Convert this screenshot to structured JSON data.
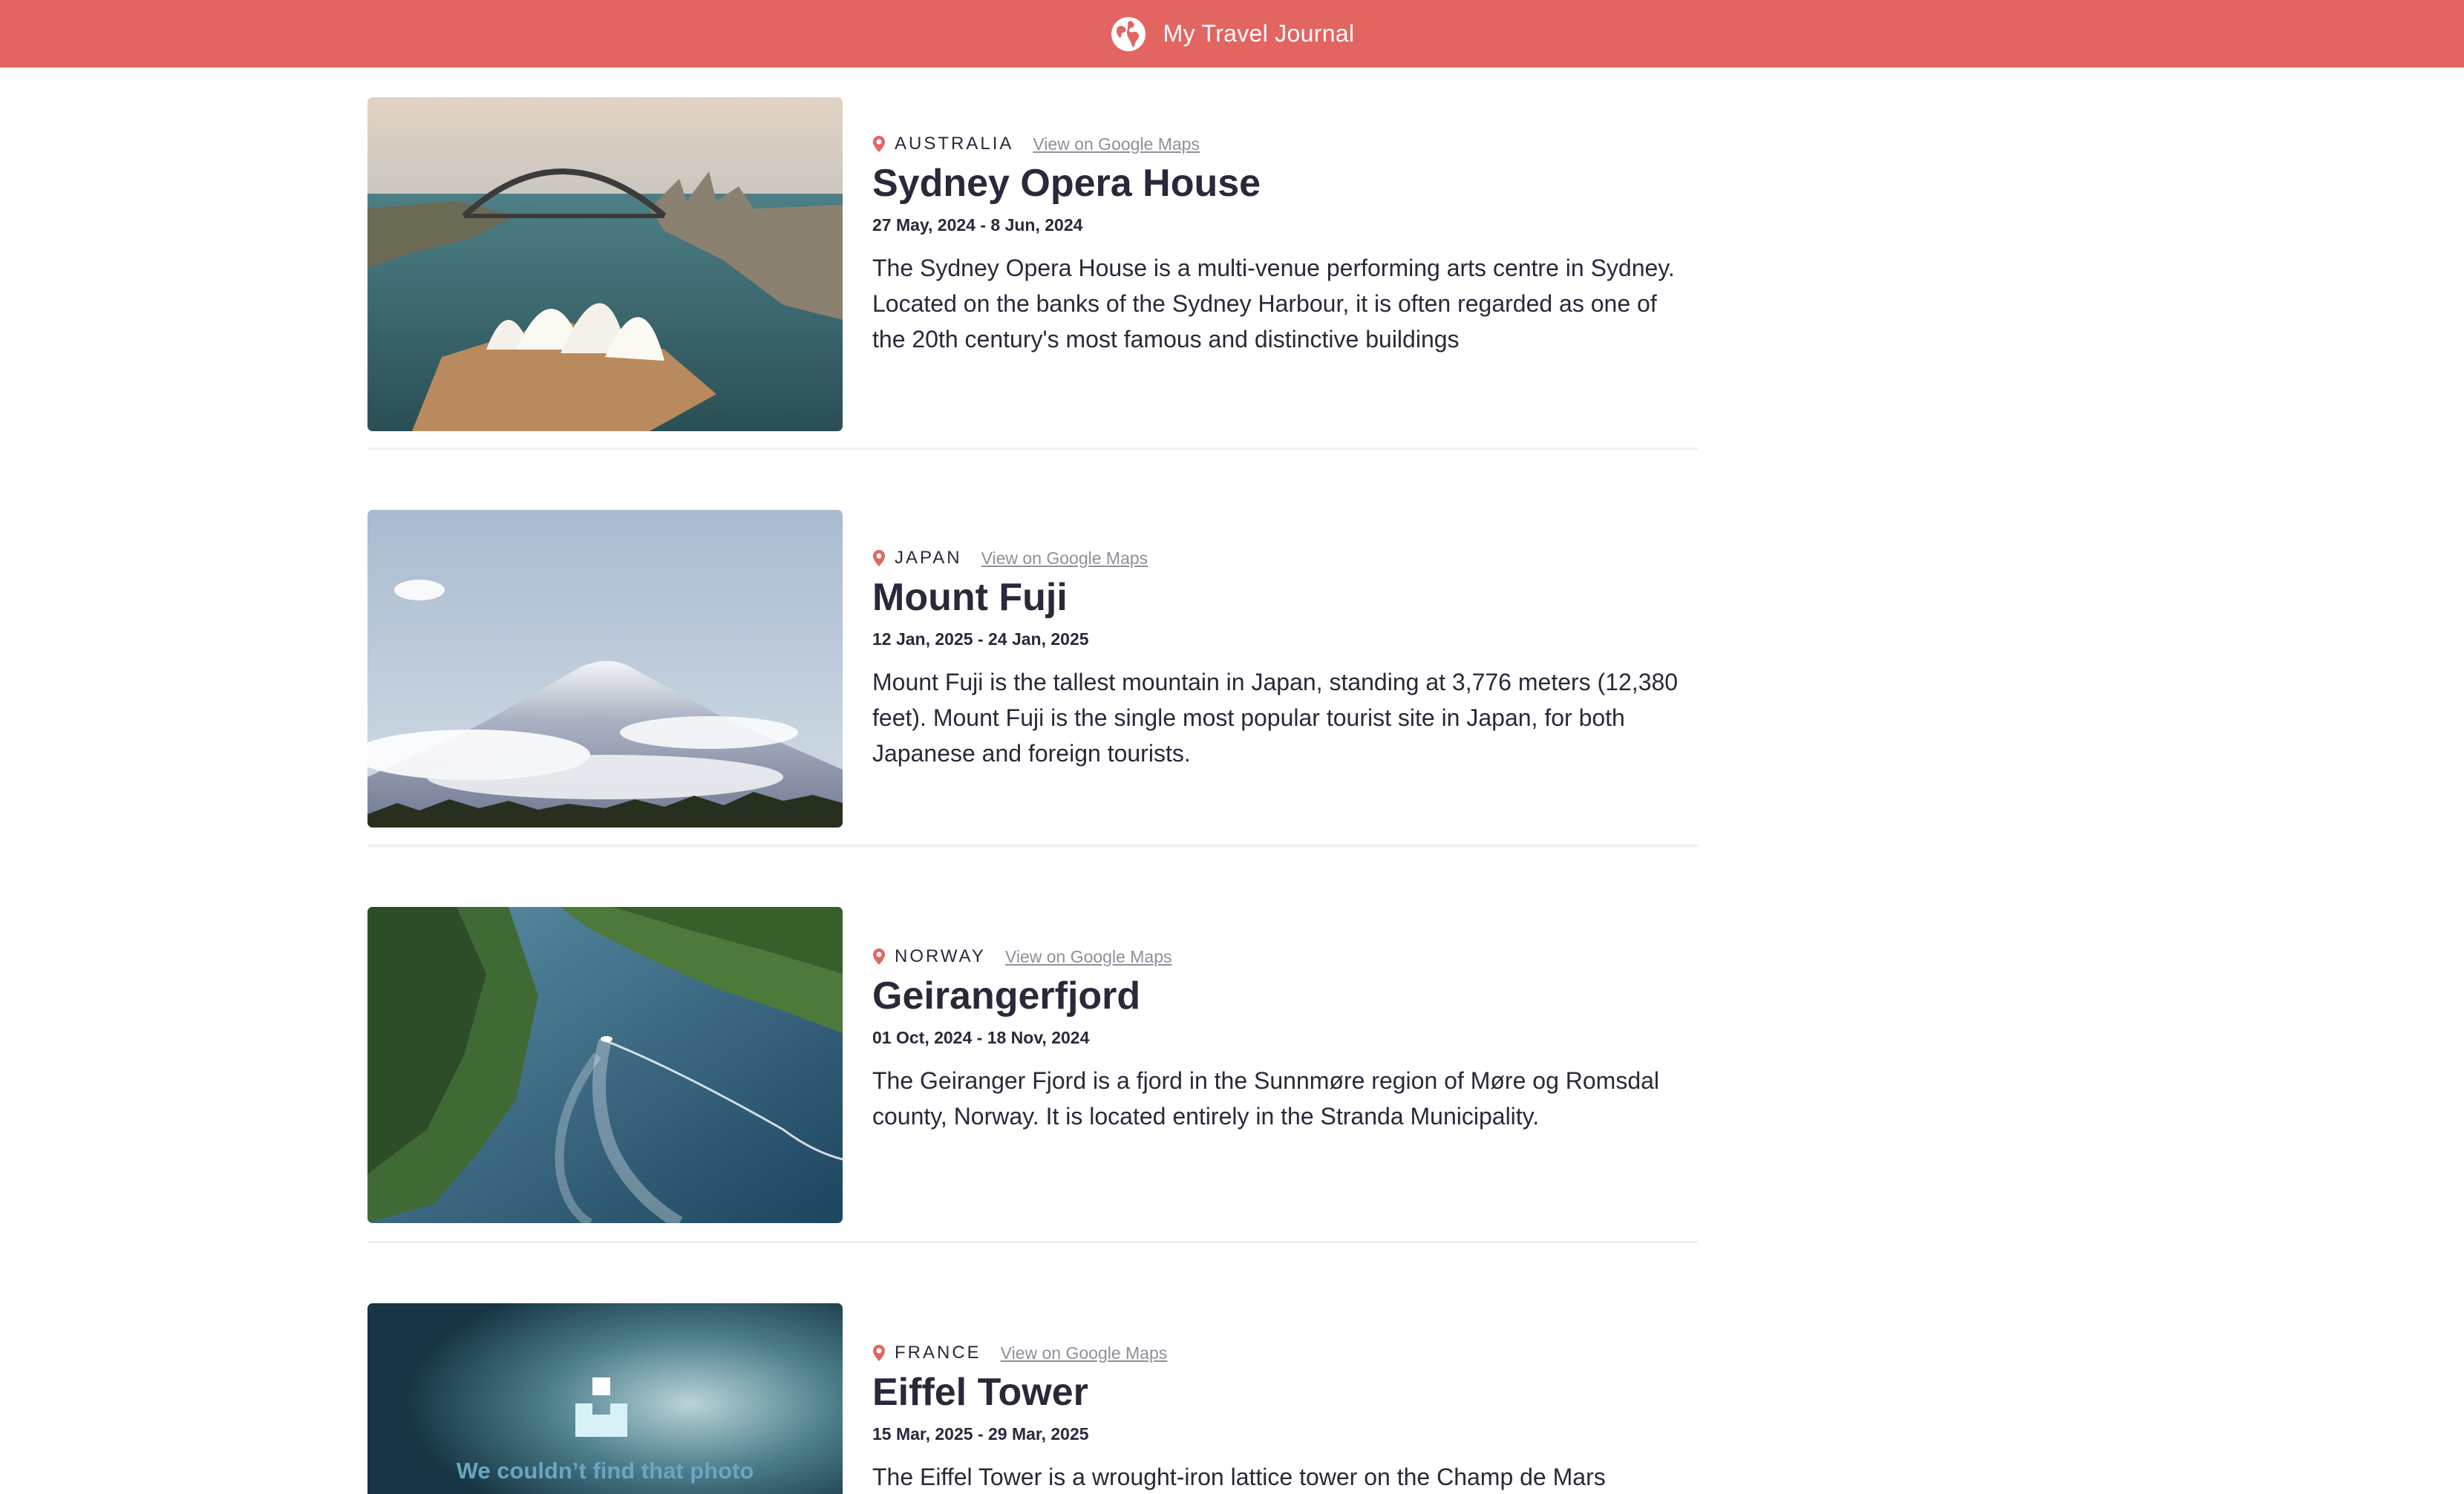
{
  "header": {
    "title": "My Travel Journal",
    "icon": "globe-icon",
    "background_color": "#E36561"
  },
  "entries": [
    {
      "country": "AUSTRALIA",
      "maps_link": "View on Google Maps",
      "title": "Sydney Opera House",
      "dates": "27 May, 2024 - 8 Jun, 2024",
      "description": "The Sydney Opera House is a multi-venue performing arts centre in Sydney. Located on the banks of the Sydney Harbour, it is often regarded as one of the 20th century's most famous and distinctive buildings"
    },
    {
      "country": "JAPAN",
      "maps_link": "View on Google Maps",
      "title": "Mount Fuji",
      "dates": "12 Jan, 2025 - 24 Jan, 2025",
      "description": "Mount Fuji is the tallest mountain in Japan, standing at 3,776 meters (12,380 feet). Mount Fuji is the single most popular tourist site in Japan, for both Japanese and foreign tourists."
    },
    {
      "country": "NORWAY",
      "maps_link": "View on Google Maps",
      "title": "Geirangerfjord",
      "dates": "01 Oct, 2024 - 18 Nov, 2024",
      "description": "The Geiranger Fjord is a fjord in the Sunnmøre region of Møre og Romsdal county, Norway. It is located entirely in the Stranda Municipality."
    },
    {
      "country": "FRANCE",
      "maps_link": "View on Google Maps",
      "title": "Eiffel Tower",
      "dates": "15 Mar, 2025 - 29 Mar, 2025",
      "description": "The Eiffel Tower is a wrought-iron lattice tower on the Champ de Mars",
      "photo_error_text": "We couldn’t find that photo"
    }
  ],
  "colors": {
    "accent": "#E36561",
    "text_dark": "#2B283A",
    "link_gray": "#918E9B",
    "divider": "#F0F0F0"
  }
}
